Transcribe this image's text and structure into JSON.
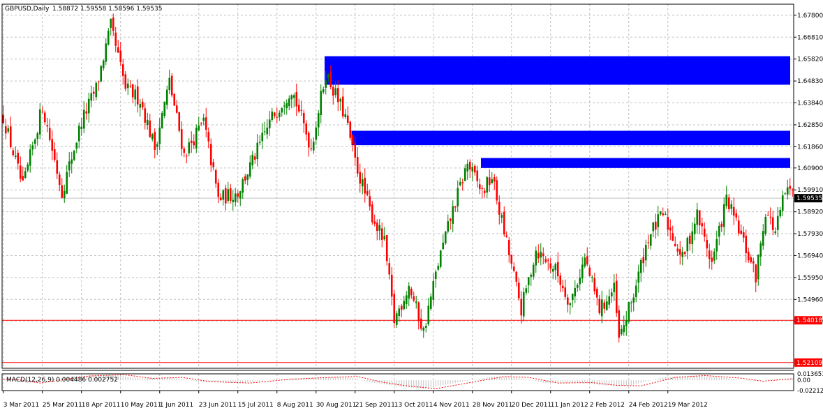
{
  "header": {
    "symbol_label": "GBPUSD,Daily",
    "ohlc_label": "1.58872 1.59558 1.58596 1.59535"
  },
  "macd": {
    "label": "MACD(12,26,9) 0.004486 0.002752",
    "ticks": [
      "0.013651",
      "0.00",
      "-0.02212"
    ]
  },
  "colors": {
    "background": "#ffffff",
    "grid": "#c0c0c0",
    "axis": "#000000",
    "bull": "#008000",
    "bear": "#ff0000",
    "zone": "#0000ff",
    "support_line": "#ff0000",
    "price_label_bg": "#000000",
    "level_label_bg": "#ff0000"
  },
  "chart_data": {
    "type": "candlestick",
    "title": "GBPUSD,Daily",
    "ylim": [
      1.5185,
      1.683
    ],
    "y_ticks": [
      "1.67800",
      "1.66810",
      "1.65820",
      "1.64830",
      "1.63840",
      "1.62850",
      "1.61860",
      "1.60900",
      "1.59910",
      "1.58920",
      "1.57930",
      "1.56940",
      "1.55950",
      "1.54960",
      "1.53980"
    ],
    "x_labels": [
      "3 Mar 2011",
      "25 Mar 2011",
      "18 Apr 2011",
      "10 May 2011",
      "1 Jun 2011",
      "23 Jun 2011",
      "15 Jul 2011",
      "8 Aug 2011",
      "30 Aug 2011",
      "21 Sep 2011",
      "13 Oct 2011",
      "4 Nov 2011",
      "28 Nov 2011",
      "20 Dec 2011",
      "11 Jan 2012",
      "2 Feb 2012",
      "24 Feb 2012",
      "19 Mar 2012"
    ],
    "bars_per_label": 16,
    "current_price": "1.59535",
    "horizontal_lines": [
      {
        "price": "1.54018",
        "color": "#ff0000"
      },
      {
        "price": "1.52109",
        "color": "#ff0000"
      }
    ],
    "zones": [
      {
        "top": 1.6595,
        "bottom": 1.6466,
        "start_index": 132
      },
      {
        "top": 1.6258,
        "bottom": 1.6193,
        "start_index": 143
      },
      {
        "top": 1.6135,
        "bottom": 1.609,
        "start_index": 196
      }
    ],
    "close_path": [
      [
        0,
        1.632
      ],
      [
        8,
        1.6
      ],
      [
        16,
        1.637
      ],
      [
        24,
        1.598
      ],
      [
        32,
        1.63
      ],
      [
        38,
        1.645
      ],
      [
        44,
        1.673
      ],
      [
        50,
        1.645
      ],
      [
        56,
        1.64
      ],
      [
        62,
        1.618
      ],
      [
        68,
        1.648
      ],
      [
        74,
        1.615
      ],
      [
        82,
        1.63
      ],
      [
        88,
        1.595
      ],
      [
        96,
        1.598
      ],
      [
        102,
        1.612
      ],
      [
        110,
        1.632
      ],
      [
        118,
        1.645
      ],
      [
        126,
        1.618
      ],
      [
        132,
        1.652
      ],
      [
        140,
        1.632
      ],
      [
        144,
        1.612
      ],
      [
        150,
        1.59
      ],
      [
        156,
        1.575
      ],
      [
        160,
        1.54
      ],
      [
        166,
        1.556
      ],
      [
        172,
        1.535
      ],
      [
        178,
        1.566
      ],
      [
        184,
        1.59
      ],
      [
        190,
        1.611
      ],
      [
        196,
        1.598
      ],
      [
        200,
        1.605
      ],
      [
        206,
        1.575
      ],
      [
        212,
        1.545
      ],
      [
        218,
        1.572
      ],
      [
        226,
        1.563
      ],
      [
        232,
        1.548
      ],
      [
        238,
        1.568
      ],
      [
        244,
        1.545
      ],
      [
        250,
        1.554
      ],
      [
        252,
        1.531
      ],
      [
        258,
        1.552
      ],
      [
        264,
        1.578
      ],
      [
        270,
        1.588
      ],
      [
        278,
        1.568
      ],
      [
        284,
        1.588
      ],
      [
        290,
        1.566
      ],
      [
        296,
        1.595
      ],
      [
        302,
        1.578
      ],
      [
        308,
        1.56
      ],
      [
        312,
        1.59
      ],
      [
        316,
        1.58
      ],
      [
        320,
        1.598
      ]
    ]
  },
  "macd_data": {
    "ylim": [
      -0.02212,
      0.013651
    ],
    "path": [
      [
        0,
        0.002
      ],
      [
        10,
        -0.006
      ],
      [
        30,
        0.009
      ],
      [
        44,
        0.012
      ],
      [
        56,
        0.004
      ],
      [
        68,
        0.006
      ],
      [
        80,
        -0.003
      ],
      [
        96,
        -0.006
      ],
      [
        112,
        0.002
      ],
      [
        128,
        0.006
      ],
      [
        140,
        0.008
      ],
      [
        150,
        -0.004
      ],
      [
        160,
        -0.012
      ],
      [
        172,
        -0.018
      ],
      [
        186,
        -0.005
      ],
      [
        200,
        0.008
      ],
      [
        210,
        0.006
      ],
      [
        222,
        -0.006
      ],
      [
        236,
        -0.005
      ],
      [
        246,
        -0.011
      ],
      [
        256,
        -0.012
      ],
      [
        270,
        0.006
      ],
      [
        282,
        0.01
      ],
      [
        296,
        0.005
      ],
      [
        306,
        -0.002
      ],
      [
        320,
        0.004
      ]
    ]
  }
}
